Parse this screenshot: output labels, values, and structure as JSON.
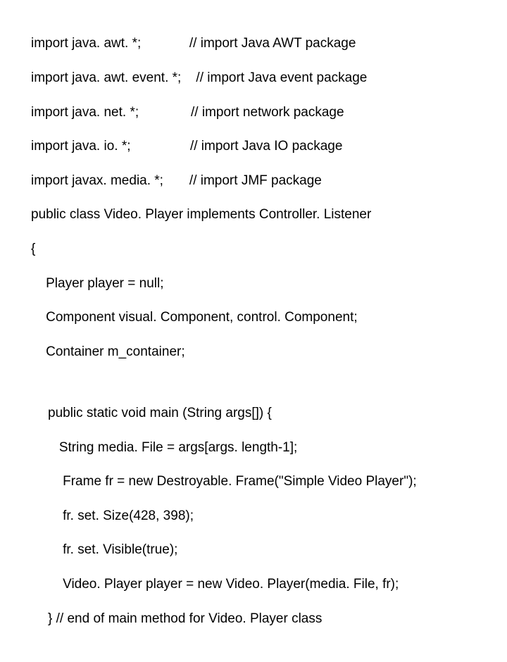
{
  "lines_block1": [
    "import java. awt. *;             // import Java AWT package",
    "import java. awt. event. *;    // import Java event package",
    "import java. net. *;              // import network package",
    "import java. io. *;                // import Java IO package",
    "import javax. media. *;       // import JMF package",
    "public class Video. Player implements Controller. Listener",
    "{",
    "    Player player = null;",
    "    Component visual. Component, control. Component;",
    "    Container m_container;"
  ],
  "lines_block2": [
    "public static void main (String args[]) {",
    "   String media. File = args[args. length-1];",
    "    Frame fr = new Destroyable. Frame(\"Simple Video Player\");",
    "    fr. set. Size(428, 398);",
    "    fr. set. Visible(true);",
    "    Video. Player player = new Video. Player(media. File, fr);",
    "} // end of main method for Video. Player class"
  ]
}
